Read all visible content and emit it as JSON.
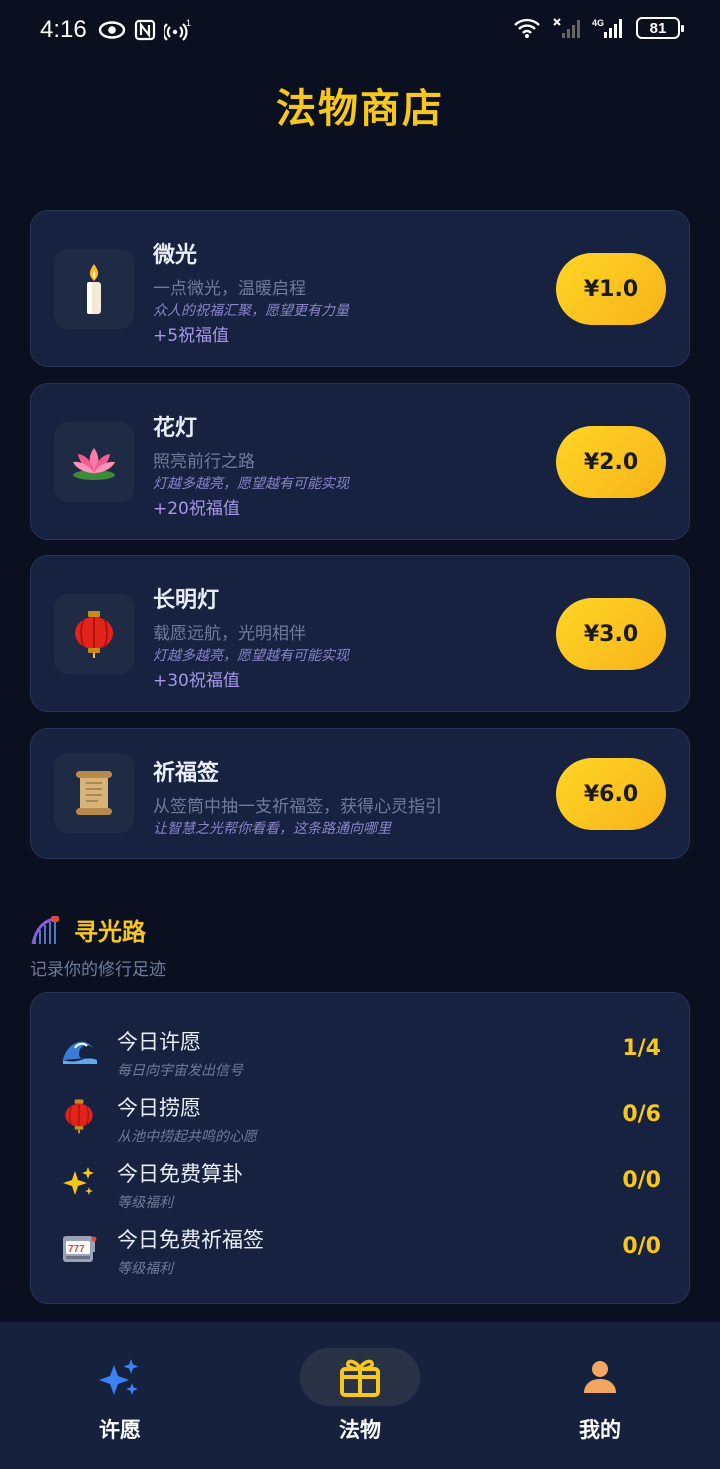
{
  "status_bar": {
    "time": "4:16",
    "battery": "81"
  },
  "page": {
    "title": "法物商店"
  },
  "products": [
    {
      "name": "微光",
      "desc": "一点微光，温暖启程",
      "tip": "众人的祝福汇聚，愿望更有力量",
      "bonus": "+5祝福值",
      "price": "¥1.0",
      "icon": "candle-icon"
    },
    {
      "name": "花灯",
      "desc": "照亮前行之路",
      "tip": "灯越多越亮，愿望越有可能实现",
      "bonus": "+20祝福值",
      "price": "¥2.0",
      "icon": "lotus-icon"
    },
    {
      "name": "长明灯",
      "desc": "载愿远航，光明相伴",
      "tip": "灯越多越亮，愿望越有可能实现",
      "bonus": "+30祝福值",
      "price": "¥3.0",
      "icon": "red-lantern-icon"
    },
    {
      "name": "祈福签",
      "desc": "从签筒中抽一支祈福签，获得心灵指引",
      "tip": "让智慧之光帮你看看，这条路通向哪里",
      "price": "¥6.0",
      "icon": "scroll-icon"
    }
  ],
  "section": {
    "title": "寻光路",
    "subtitle": "记录你的修行足迹",
    "icon": "roller-coaster-icon"
  },
  "tasks": [
    {
      "name": "今日许愿",
      "sub": "每日向宇宙发出信号",
      "count": "1/4",
      "icon": "wave-icon"
    },
    {
      "name": "今日捞愿",
      "sub": "从池中捞起共鸣的心愿",
      "count": "0/6",
      "icon": "red-lantern-icon"
    },
    {
      "name": "今日免费算卦",
      "sub": "等级福利",
      "count": "0/0",
      "icon": "sparkles-icon"
    },
    {
      "name": "今日免费祈福签",
      "sub": "等级福利",
      "count": "0/0",
      "icon": "slot-machine-icon"
    }
  ],
  "nav": {
    "items": [
      {
        "label": "许愿",
        "icon": "sparkles-icon"
      },
      {
        "label": "法物",
        "icon": "gift-icon",
        "active": true
      },
      {
        "label": "我的",
        "icon": "person-icon"
      }
    ]
  },
  "colors": {
    "accent": "#f7c81b",
    "background": "#0a1020",
    "card": "#16223f",
    "bonus": "#a797e8"
  }
}
